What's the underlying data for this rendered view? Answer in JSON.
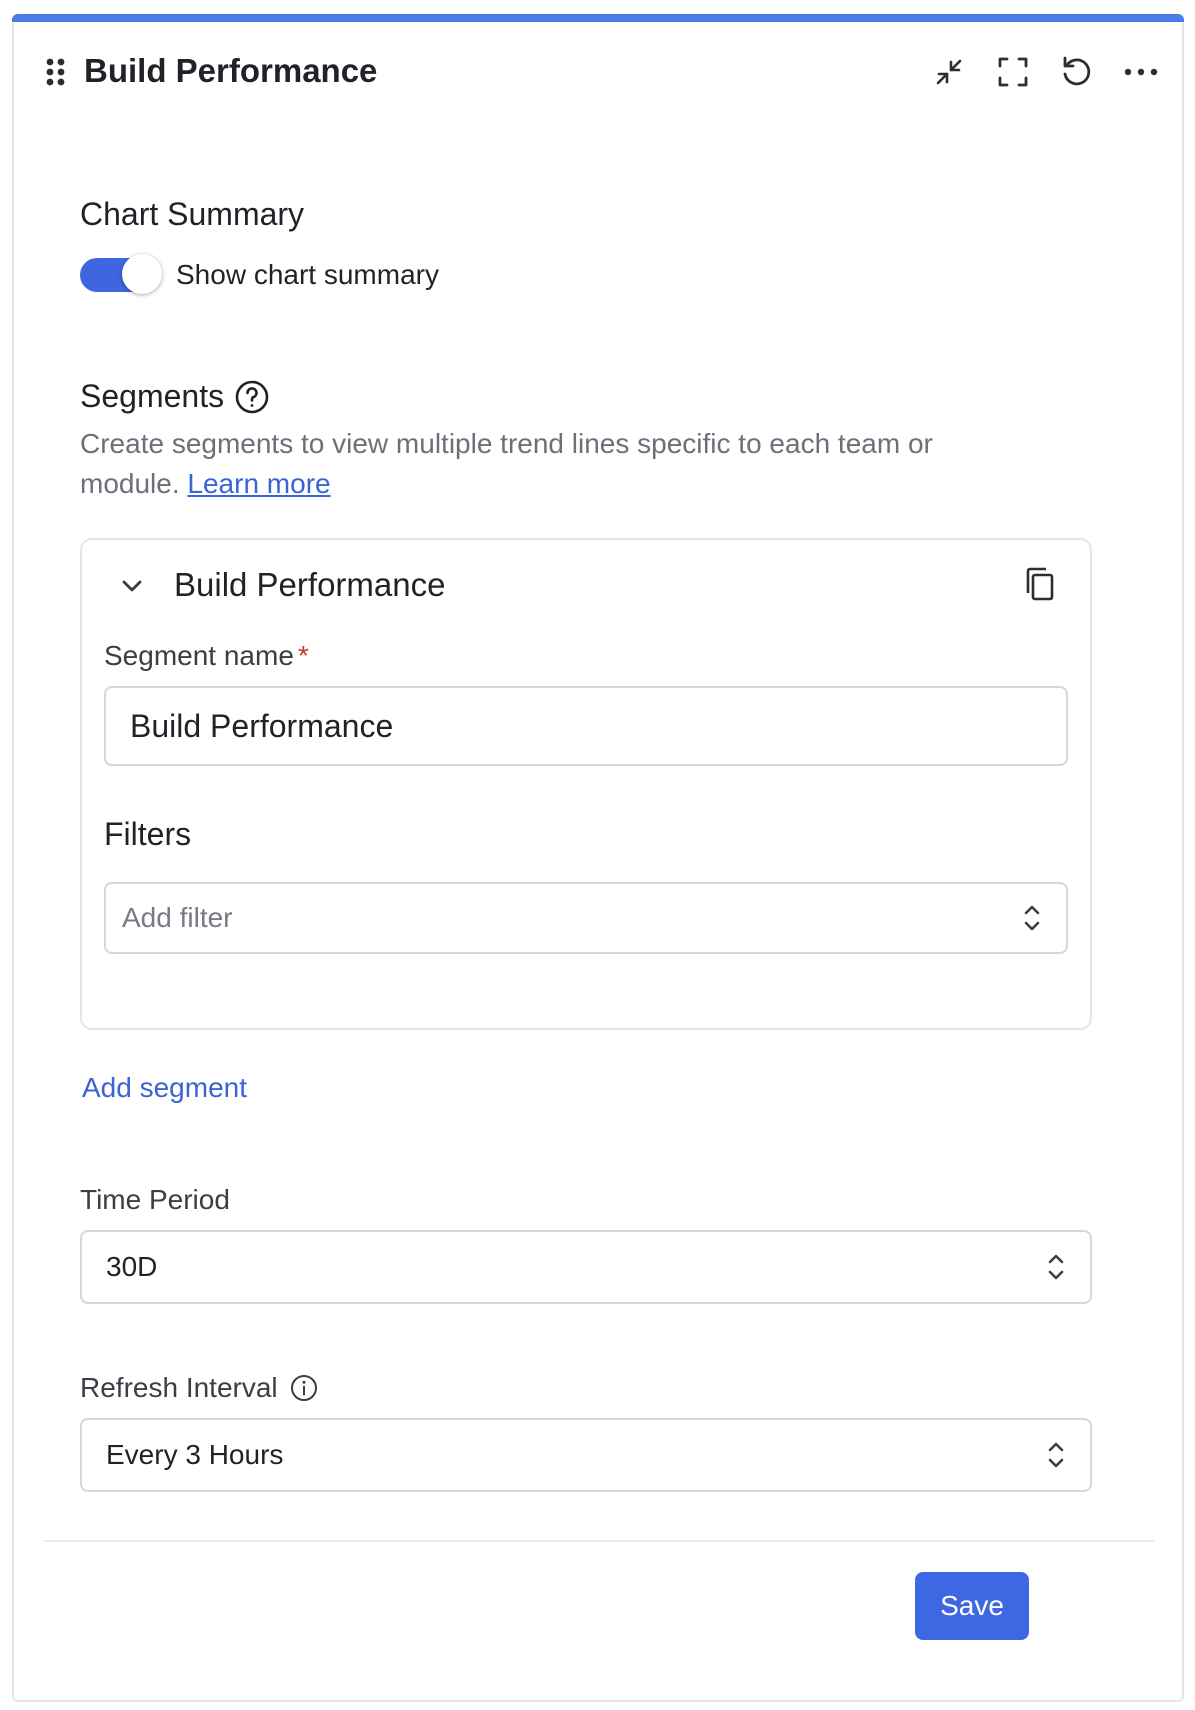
{
  "colors": {
    "accent": "#4b7be5",
    "toggle_on": "#3f66e0",
    "primary_button": "#3e68e3",
    "link": "#3b63d6",
    "required": "#c7372f"
  },
  "widget": {
    "title": "Build Performance",
    "actions": [
      {
        "name": "collapse-icon"
      },
      {
        "name": "expand-icon"
      },
      {
        "name": "reset-icon"
      },
      {
        "name": "more-icon"
      }
    ]
  },
  "chart_summary": {
    "title": "Chart Summary",
    "toggle_label": "Show chart summary",
    "enabled": true
  },
  "segments": {
    "title": "Segments",
    "help_text": "Create segments to view multiple trend lines specific to each team or module.",
    "learn_more": "Learn more",
    "items": [
      {
        "title": "Build Performance",
        "expanded": true,
        "name_label": "Segment name",
        "name_value": "Build Performance",
        "filters_title": "Filters",
        "filter_placeholder": "Add filter"
      }
    ],
    "add_label": "Add segment"
  },
  "time_period": {
    "label": "Time Period",
    "value": "30D"
  },
  "refresh_interval": {
    "label": "Refresh Interval",
    "value": "Every 3 Hours"
  },
  "footer": {
    "save_label": "Save"
  }
}
